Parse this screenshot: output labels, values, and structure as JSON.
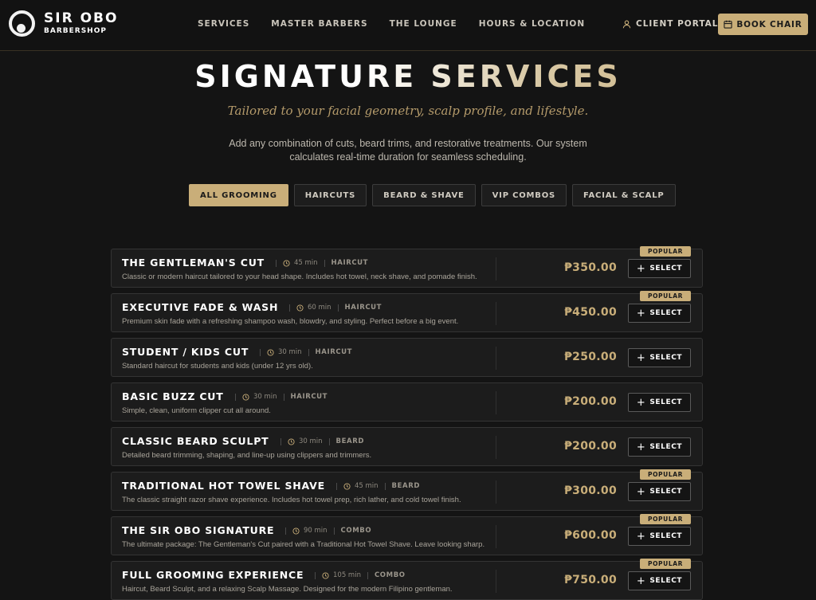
{
  "brand": {
    "name": "SIR OBO",
    "sub": "BARBERSHOP"
  },
  "nav": [
    "SERVICES",
    "MASTER BARBERS",
    "THE LOUNGE",
    "HOURS & LOCATION"
  ],
  "header": {
    "client_label": "CLIENT PORTAL",
    "book_label": "BOOK CHAIR"
  },
  "hero": {
    "title": "SIGNATURE SERVICES",
    "subtitle": "Tailored to your facial geometry, scalp profile, and lifestyle.",
    "description": "Add any combination of cuts, beard trims, and restorative treatments. Our system calculates real-time duration for seamless scheduling."
  },
  "tabs": [
    {
      "label": "ALL GROOMING",
      "active": true
    },
    {
      "label": "HAIRCUTS",
      "active": false
    },
    {
      "label": "BEARD & SHAVE",
      "active": false
    },
    {
      "label": "VIP COMBOS",
      "active": false
    },
    {
      "label": "FACIAL & SCALP",
      "active": false
    }
  ],
  "services": [
    {
      "name": "THE GENTLEMAN'S CUT",
      "duration": "45 min",
      "category": "HAIRCUT",
      "description": "Classic or modern haircut tailored to your head shape. Includes hot towel, neck shave, and pomade finish.",
      "price": "₱350.00",
      "badge": "POPULAR"
    },
    {
      "name": "EXECUTIVE FADE & WASH",
      "duration": "60 min",
      "category": "HAIRCUT",
      "description": "Premium skin fade with a refreshing shampoo wash, blowdry, and styling. Perfect before a big event.",
      "price": "₱450.00",
      "badge": "POPULAR"
    },
    {
      "name": "STUDENT / KIDS CUT",
      "duration": "30 min",
      "category": "HAIRCUT",
      "description": "Standard haircut for students and kids (under 12 yrs old).",
      "price": "₱250.00",
      "badge": ""
    },
    {
      "name": "BASIC BUZZ CUT",
      "duration": "30 min",
      "category": "HAIRCUT",
      "description": "Simple, clean, uniform clipper cut all around.",
      "price": "₱200.00",
      "badge": ""
    },
    {
      "name": "CLASSIC BEARD SCULPT",
      "duration": "30 min",
      "category": "BEARD",
      "description": "Detailed beard trimming, shaping, and line-up using clippers and trimmers.",
      "price": "₱200.00",
      "badge": ""
    },
    {
      "name": "TRADITIONAL HOT TOWEL SHAVE",
      "duration": "45 min",
      "category": "BEARD",
      "description": "The classic straight razor shave experience. Includes hot towel prep, rich lather, and cold towel finish.",
      "price": "₱300.00",
      "badge": "POPULAR"
    },
    {
      "name": "THE SIR OBO SIGNATURE",
      "duration": "90 min",
      "category": "COMBO",
      "description": "The ultimate package: The Gentleman's Cut paired with a Traditional Hot Towel Shave. Leave looking sharp.",
      "price": "₱600.00",
      "badge": "POPULAR"
    },
    {
      "name": "FULL GROOMING EXPERIENCE",
      "duration": "105 min",
      "category": "COMBO",
      "description": "Haircut, Beard Sculpt, and a relaxing Scalp Massage. Designed for the modern Filipino gentleman.",
      "price": "₱750.00",
      "badge": "POPULAR"
    }
  ],
  "select_label": "SELECT",
  "colors": {
    "accent": "#c9ae79",
    "background": "#141414",
    "card": "#1c1c1c"
  },
  "icons": {
    "logo": "logo-circle-icon",
    "client": "user-icon",
    "book": "calendar-icon",
    "duration": "clock-icon",
    "select": "plus-icon"
  }
}
